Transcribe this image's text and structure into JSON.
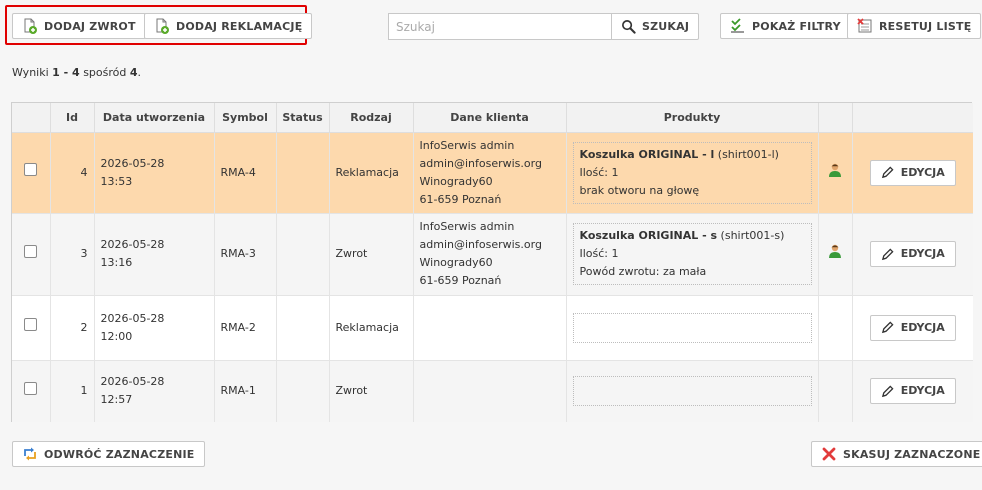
{
  "toolbar": {
    "add_return_label": "DODAJ ZWROT",
    "add_complaint_label": "DODAJ REKLAMACJĘ",
    "search_placeholder": "Szukaj",
    "search_label": "SZUKAJ",
    "show_filters_label": "POKAŻ FILTRY",
    "reset_list_label": "RESETUJ LISTĘ"
  },
  "results": {
    "prefix": "Wyniki",
    "range": "1 - 4",
    "of": "spośród",
    "total": "4",
    "suffix": "."
  },
  "table": {
    "columns": {
      "id": "Id",
      "created": "Data utworzenia",
      "symbol": "Symbol",
      "status": "Status",
      "type": "Rodzaj",
      "client": "Dane klienta",
      "products": "Produkty"
    },
    "edit_label": "EDYCJA",
    "rows": [
      {
        "id": "4",
        "date": "2026-05-28",
        "time": "13:53",
        "symbol": "RMA-4",
        "status": "",
        "type": "Reklamacja",
        "client": [
          "InfoSerwis admin",
          "admin@infoserwis.org",
          "Winogrady60",
          "61-659 Poznań"
        ],
        "product_name": "Koszulka ORIGINAL - l",
        "product_code": " (shirt001-l)",
        "product_lines": [
          "Ilość: 1",
          "brak otworu na głowę"
        ],
        "has_user_icon": true
      },
      {
        "id": "3",
        "date": "2026-05-28",
        "time": "13:16",
        "symbol": "RMA-3",
        "status": "",
        "type": "Zwrot",
        "client": [
          "InfoSerwis admin",
          "admin@infoserwis.org",
          "Winogrady60",
          "61-659 Poznań"
        ],
        "product_name": "Koszulka ORIGINAL - s",
        "product_code": " (shirt001-s)",
        "product_lines": [
          "Ilość: 1",
          "Powód zwrotu: za mała"
        ],
        "has_user_icon": true
      },
      {
        "id": "2",
        "date": "2026-05-28",
        "time": "12:00",
        "symbol": "RMA-2",
        "status": "",
        "type": "Reklamacja",
        "client": [],
        "product_name": "",
        "product_code": "",
        "product_lines": [],
        "has_user_icon": false
      },
      {
        "id": "1",
        "date": "2026-05-28",
        "time": "12:57",
        "symbol": "RMA-1",
        "status": "",
        "type": "Zwrot",
        "client": [],
        "product_name": "",
        "product_code": "",
        "product_lines": [],
        "has_user_icon": false
      }
    ]
  },
  "footer": {
    "invert_selection_label": "ODWRÓĆ ZAZNACZENIE",
    "delete_selected_label": "SKASUJ ZAZNACZONE"
  },
  "colors": {
    "highlight_border": "#e00000",
    "selected_row": "#fdd9ad",
    "add_icon_green": "#5aaa2a",
    "delete_icon_red": "#e23b3b",
    "invert_icon_blue": "#3a7fd0"
  },
  "icons": {
    "add_return": "document-add-icon",
    "add_complaint": "document-add-icon",
    "search": "magnifier-icon",
    "show_filters": "filter-check-icon",
    "reset_list": "reset-list-icon",
    "user": "user-icon",
    "edit": "pencil-icon",
    "invert": "invert-arrows-icon",
    "delete": "delete-x-icon"
  }
}
